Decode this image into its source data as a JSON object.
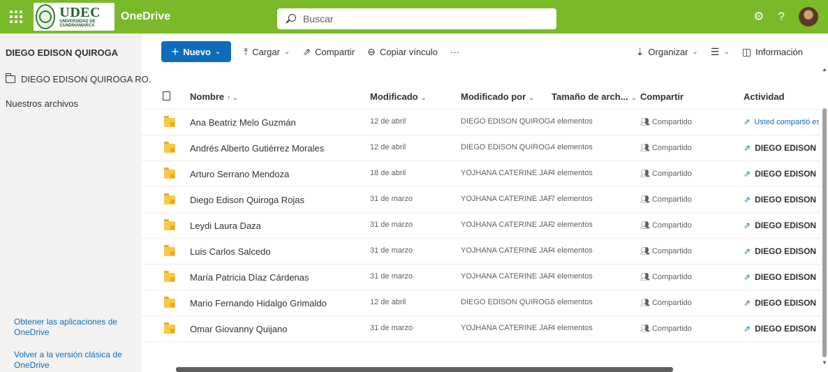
{
  "topbar": {
    "app_title": "OneDrive",
    "logo_text": "UDEC",
    "logo_sub": "UNIVERSIDAD DE CUNDINAMARCA",
    "search_placeholder": "Buscar",
    "icons": [
      "waffle-icon",
      "gear-icon",
      "help-icon",
      "avatar"
    ],
    "brand_color": "#7ab929"
  },
  "sidebar": {
    "user_name": "DIEGO EDISON QUIROGA",
    "folder_item": "DIEGO EDISON QUIROGA RO.",
    "shared_link": "Nuestros archivos",
    "get_apps": "Obtener las aplicaciones de OneDrive",
    "classic": "Volver a la versión clásica de OneDrive"
  },
  "toolbar": {
    "new_label": "Nuevo",
    "upload_label": "Cargar",
    "share_label": "Compartir",
    "copy_link_label": "Copiar vínculo",
    "more_label": "···",
    "sort_label": "Organizar",
    "info_label": "Información",
    "accent_color": "#0f6cbd"
  },
  "columns": {
    "name": "Nombre",
    "modified": "Modificado",
    "modified_by": "Modificado por",
    "size": "Tamaño de arch...",
    "sharing": "Compartir",
    "activity": "Actividad"
  },
  "rows": [
    {
      "name": "Ana Beatriz Melo Guzmán",
      "modified": "12 de abril",
      "modified_by": "DIEGO EDISON QUIROGA",
      "size": "4 elementos",
      "sharing": "Compartido",
      "activity": "Usted compartió es",
      "activity_bold": false
    },
    {
      "name": "Andrés Alberto Gutiérrez Morales",
      "modified": "12 de abril",
      "modified_by": "DIEGO EDISON QUIROGA",
      "size": "4 elementos",
      "sharing": "Compartido",
      "activity": "DIEGO EDISON QU",
      "activity_bold": true
    },
    {
      "name": "Arturo Serrano Mendoza",
      "modified": "18 de abril",
      "modified_by": "YOJHANA CATERINE JARA",
      "size": "4 elementos",
      "sharing": "Compartido",
      "activity": "DIEGO EDISON QU",
      "activity_bold": true
    },
    {
      "name": "Diego Edison Quiroga Rojas",
      "modified": "31 de marzo",
      "modified_by": "YOJHANA CATERINE JARA",
      "size": "7 elementos",
      "sharing": "Compartido",
      "activity": "DIEGO EDISON QU",
      "activity_bold": true
    },
    {
      "name": "Leydi Laura Daza",
      "modified": "31 de marzo",
      "modified_by": "YOJHANA CATERINE JARA",
      "size": "2 elementos",
      "sharing": "Compartido",
      "activity": "DIEGO EDISON QU",
      "activity_bold": true
    },
    {
      "name": "Luis Carlos Salcedo",
      "modified": "31 de marzo",
      "modified_by": "YOJHANA CATERINE JARA",
      "size": "4 elementos",
      "sharing": "Compartido",
      "activity": "DIEGO EDISON QU",
      "activity_bold": true
    },
    {
      "name": "María Patricia Díaz Cárdenas",
      "modified": "31 de marzo",
      "modified_by": "YOJHANA CATERINE JARA",
      "size": "4 elementos",
      "sharing": "Compartido",
      "activity": "DIEGO EDISON QU",
      "activity_bold": true
    },
    {
      "name": "Mario Fernando Hidalgo Grimaldo",
      "modified": "12 de abril",
      "modified_by": "DIEGO EDISON QUIROGA",
      "size": "5 elementos",
      "sharing": "Compartido",
      "activity": "DIEGO EDISON QU",
      "activity_bold": true
    },
    {
      "name": "Omar Giovanny Quijano",
      "modified": "31 de marzo",
      "modified_by": "YOJHANA CATERINE JARA",
      "size": "4 elementos",
      "sharing": "Compartido",
      "activity": "DIEGO EDISON QU",
      "activity_bold": true
    }
  ]
}
